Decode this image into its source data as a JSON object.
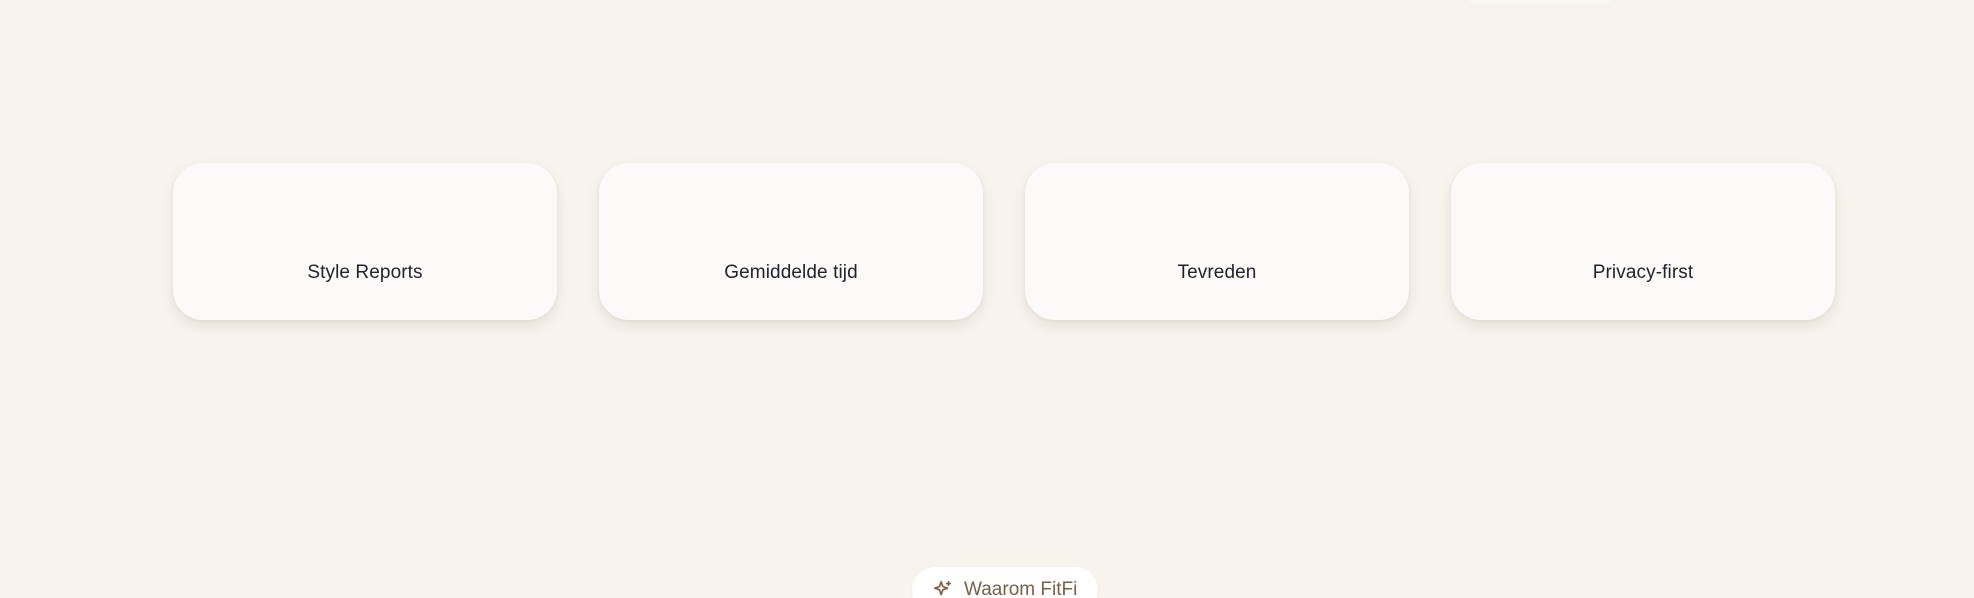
{
  "stats": [
    {
      "value": "",
      "label": "Style Reports"
    },
    {
      "value": "",
      "label": "Gemiddelde tijd"
    },
    {
      "value": "",
      "label": "Tevreden"
    },
    {
      "value": "",
      "label": "Privacy-first"
    }
  ],
  "why_badge": {
    "icon": "sparkles-icon",
    "label": "Waarom FitFi"
  },
  "colors": {
    "background": "#f7f4ee",
    "card": "#fbfaf8",
    "text": "#23232d",
    "accent": "#7a5f46"
  }
}
